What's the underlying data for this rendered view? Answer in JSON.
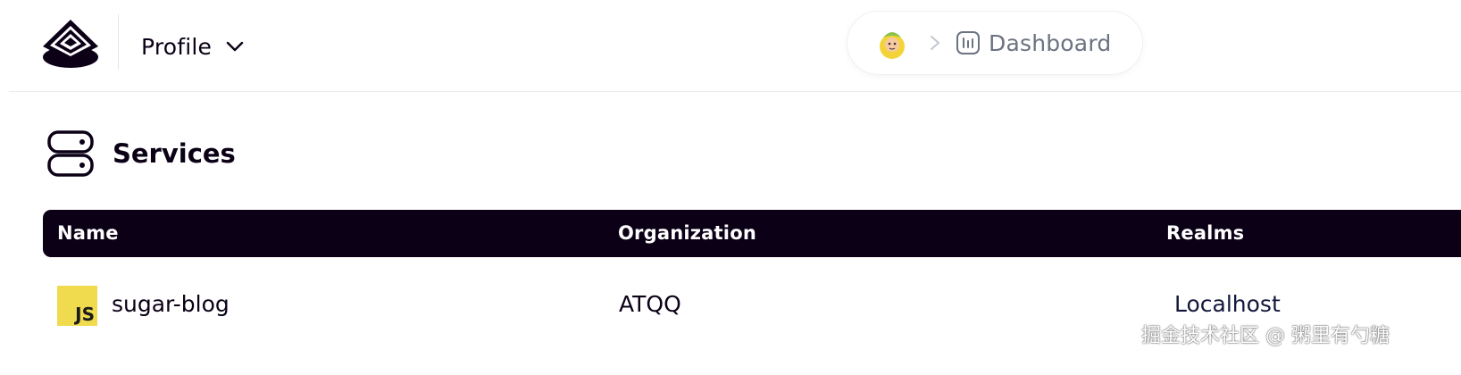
{
  "header": {
    "profile_label": "Profile",
    "breadcrumb": {
      "avatar_icon": "user-avatar-icon",
      "separator_icon": "chevron-right-icon",
      "page_icon": "dashboard-chart-icon",
      "page_label": "Dashboard"
    }
  },
  "services": {
    "title": "Services",
    "icon": "server-stack-icon",
    "columns": [
      "Name",
      "Organization",
      "Realms"
    ],
    "rows": [
      {
        "icon": "javascript-icon",
        "icon_text": "JS",
        "name": "sugar-blog",
        "organization": "ATQQ",
        "realm": "Localhost"
      }
    ]
  },
  "watermark": "掘金技术社区 @ 粥里有勺糖",
  "colors": {
    "header_dark": "#0b0016",
    "js_yellow": "#f0db4f",
    "muted_text": "#6b7280"
  }
}
